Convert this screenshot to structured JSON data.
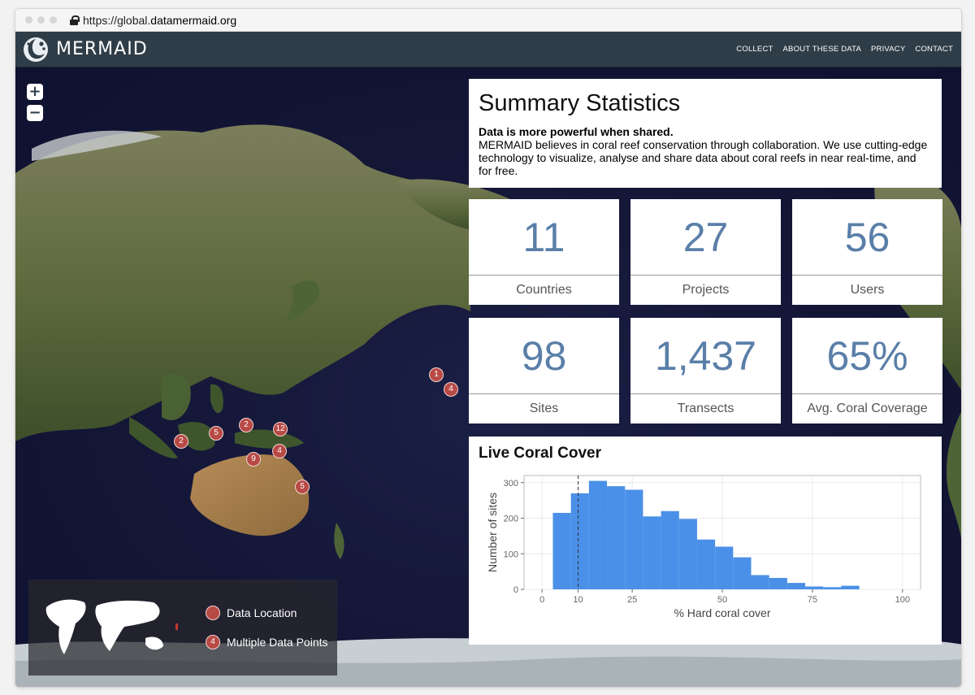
{
  "browser": {
    "url_prefix": "https://global.",
    "url_domain": "datamermaid.org"
  },
  "app": {
    "brand": "MERMAID",
    "nav": [
      "COLLECT",
      "ABOUT THESE DATA",
      "PRIVACY",
      "CONTACT"
    ]
  },
  "map": {
    "zoom_in": "+",
    "zoom_out": "−",
    "markers": [
      "1",
      "4",
      "2",
      "5",
      "2",
      "12",
      "4",
      "9",
      "5"
    ]
  },
  "legend": {
    "data_location": "Data Location",
    "multiple_points": "Multiple Data Points",
    "multiple_example": "4"
  },
  "summary": {
    "title": "Summary Statistics",
    "lead": "Data is more powerful when shared.",
    "description": "MERMAID believes in coral reef conservation through collaboration. We use cutting-edge technology to visualize, analyse and share data about coral reefs in near real-time, and for free."
  },
  "stats": [
    {
      "value": "11",
      "label": "Countries"
    },
    {
      "value": "27",
      "label": "Projects"
    },
    {
      "value": "56",
      "label": "Users"
    },
    {
      "value": "98",
      "label": "Sites"
    },
    {
      "value": "1,437",
      "label": "Transects"
    },
    {
      "value": "65%",
      "label": "Avg. Coral Coverage"
    }
  ],
  "chart_title": "Live Coral Cover",
  "chart_data": {
    "type": "bar",
    "title": "Live Coral Cover",
    "xlabel": "% Hard coral cover",
    "ylabel": "Number of sites",
    "xlim": [
      -5,
      105
    ],
    "ylim": [
      0,
      320
    ],
    "xticks": [
      0,
      10,
      25,
      50,
      75,
      100
    ],
    "yticks": [
      0,
      100,
      200,
      300
    ],
    "bin_width": 5,
    "bins": [
      {
        "x": 3,
        "value": 215
      },
      {
        "x": 8,
        "value": 270
      },
      {
        "x": 13,
        "value": 305
      },
      {
        "x": 18,
        "value": 290
      },
      {
        "x": 23,
        "value": 280
      },
      {
        "x": 28,
        "value": 205
      },
      {
        "x": 33,
        "value": 220
      },
      {
        "x": 38,
        "value": 198
      },
      {
        "x": 43,
        "value": 140
      },
      {
        "x": 48,
        "value": 120
      },
      {
        "x": 53,
        "value": 90
      },
      {
        "x": 58,
        "value": 40
      },
      {
        "x": 63,
        "value": 32
      },
      {
        "x": 68,
        "value": 18
      },
      {
        "x": 73,
        "value": 8
      },
      {
        "x": 78,
        "value": 6
      },
      {
        "x": 83,
        "value": 10
      }
    ],
    "reference_line_x": 10,
    "bar_color": "#4a90e8",
    "grid": true
  }
}
